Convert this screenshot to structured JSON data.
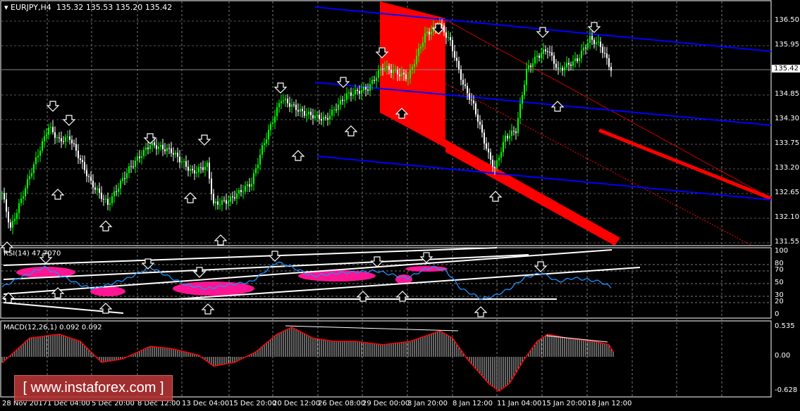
{
  "header": {
    "symbol": "EURJPY,H4",
    "open": "135.32",
    "high": "135.53",
    "low": "135.20",
    "close": "135.42"
  },
  "price_axis": [
    "136.50",
    "135.95",
    "134.85",
    "134.30",
    "133.75",
    "133.20",
    "132.65",
    "132.10",
    "131.55"
  ],
  "current_price": "135.42",
  "rsi": {
    "label": "RSI(14) 47.7070",
    "levels": [
      "100",
      "80",
      "70",
      "50",
      "30",
      "20",
      "0"
    ]
  },
  "macd": {
    "label": "MACD(12,26,1) 0.092 0.092",
    "levels": [
      "0.535",
      "0.00",
      "-0.628"
    ]
  },
  "time_axis": [
    "28 Nov 2017",
    "1 Dec 04:00",
    "5 Dec 20:00",
    "8 Dec 12:00",
    "13 Dec 04:00",
    "15 Dec 20:00",
    "20 Dec 12:00",
    "26 Dec 08:00",
    "29 Dec 00:00",
    "3 Jan 20:00",
    "8 Jan 12:00",
    "11 Jan 04:00",
    "15 Jan 20:00",
    "18 Jan 12:00"
  ],
  "watermark": "[ www.instaforex.com ]",
  "colors": {
    "bull": "#00ff00",
    "bear": "#ffffff",
    "channel": "#0000ff",
    "zone": "#ff0000",
    "rsi": "#1e90ff",
    "macd_signal": "#ff0000",
    "ellipse": "#ff1493"
  },
  "chart_data": {
    "type": "line",
    "title": "EURJPY,H4",
    "price_keypoints": [
      [
        2,
        132.26
      ],
      [
        4,
        131.86
      ],
      [
        13,
        133.04
      ],
      [
        22,
        134.14
      ],
      [
        27,
        133.83
      ],
      [
        32,
        133.9
      ],
      [
        42,
        132.89
      ],
      [
        50,
        132.41
      ],
      [
        60,
        133.2
      ],
      [
        70,
        133.75
      ],
      [
        80,
        133.6
      ],
      [
        90,
        133.12
      ],
      [
        97,
        133.28
      ],
      [
        100,
        132.41
      ],
      [
        107,
        132.49
      ],
      [
        118,
        132.89
      ],
      [
        123,
        133.67
      ],
      [
        132,
        134.77
      ],
      [
        142,
        134.46
      ],
      [
        153,
        134.3
      ],
      [
        163,
        134.85
      ],
      [
        173,
        135.0
      ],
      [
        180,
        135.48
      ],
      [
        192,
        135.24
      ],
      [
        200,
        136.19
      ],
      [
        207,
        136.42
      ],
      [
        212,
        136.03
      ],
      [
        218,
        135.09
      ],
      [
        223,
        134.61
      ],
      [
        230,
        133.51
      ],
      [
        233,
        133.2
      ],
      [
        238,
        133.9
      ],
      [
        243,
        134.06
      ],
      [
        248,
        135.4
      ],
      [
        253,
        135.71
      ],
      [
        258,
        135.87
      ],
      [
        263,
        135.4
      ],
      [
        272,
        135.64
      ],
      [
        278,
        136.11
      ],
      [
        283,
        135.95
      ],
      [
        288,
        135.42
      ]
    ],
    "rsi_keypoints": [
      [
        2,
        48
      ],
      [
        8,
        59
      ],
      [
        20,
        76
      ],
      [
        28,
        62
      ],
      [
        37,
        48
      ],
      [
        43,
        42
      ],
      [
        50,
        48
      ],
      [
        60,
        59
      ],
      [
        70,
        76
      ],
      [
        80,
        59
      ],
      [
        87,
        48
      ],
      [
        97,
        42
      ],
      [
        107,
        48
      ],
      [
        118,
        53
      ],
      [
        130,
        84
      ],
      [
        137,
        76
      ],
      [
        147,
        62
      ],
      [
        160,
        67
      ],
      [
        177,
        70
      ],
      [
        187,
        62
      ],
      [
        192,
        59
      ],
      [
        200,
        73
      ],
      [
        205,
        76
      ],
      [
        210,
        70
      ],
      [
        217,
        42
      ],
      [
        227,
        26
      ],
      [
        233,
        31
      ],
      [
        240,
        42
      ],
      [
        247,
        59
      ],
      [
        255,
        67
      ],
      [
        263,
        53
      ],
      [
        270,
        59
      ],
      [
        277,
        56
      ],
      [
        283,
        53
      ],
      [
        288,
        44
      ]
    ],
    "macd_keypoints": [
      [
        2,
        -0.04
      ],
      [
        13,
        0.34
      ],
      [
        27,
        0.41
      ],
      [
        37,
        0.28
      ],
      [
        47,
        -0.1
      ],
      [
        57,
        -0.04
      ],
      [
        70,
        0.19
      ],
      [
        80,
        0.15
      ],
      [
        93,
        0.03
      ],
      [
        100,
        -0.17
      ],
      [
        110,
        -0.1
      ],
      [
        120,
        0.09
      ],
      [
        130,
        0.41
      ],
      [
        137,
        0.535
      ],
      [
        147,
        0.34
      ],
      [
        157,
        0.28
      ],
      [
        167,
        0.28
      ],
      [
        180,
        0.22
      ],
      [
        193,
        0.28
      ],
      [
        207,
        0.47
      ],
      [
        213,
        0.34
      ],
      [
        220,
        -0.04
      ],
      [
        230,
        -0.48
      ],
      [
        235,
        -0.62
      ],
      [
        240,
        -0.48
      ],
      [
        247,
        -0.04
      ],
      [
        253,
        0.28
      ],
      [
        258,
        0.41
      ],
      [
        267,
        0.34
      ],
      [
        280,
        0.28
      ],
      [
        287,
        0.22
      ],
      [
        289,
        0.09
      ]
    ],
    "ylim": [
      131.55,
      136.5
    ],
    "rsi_ylim": [
      0,
      100
    ],
    "macd_ylim": [
      -0.628,
      0.535
    ]
  }
}
